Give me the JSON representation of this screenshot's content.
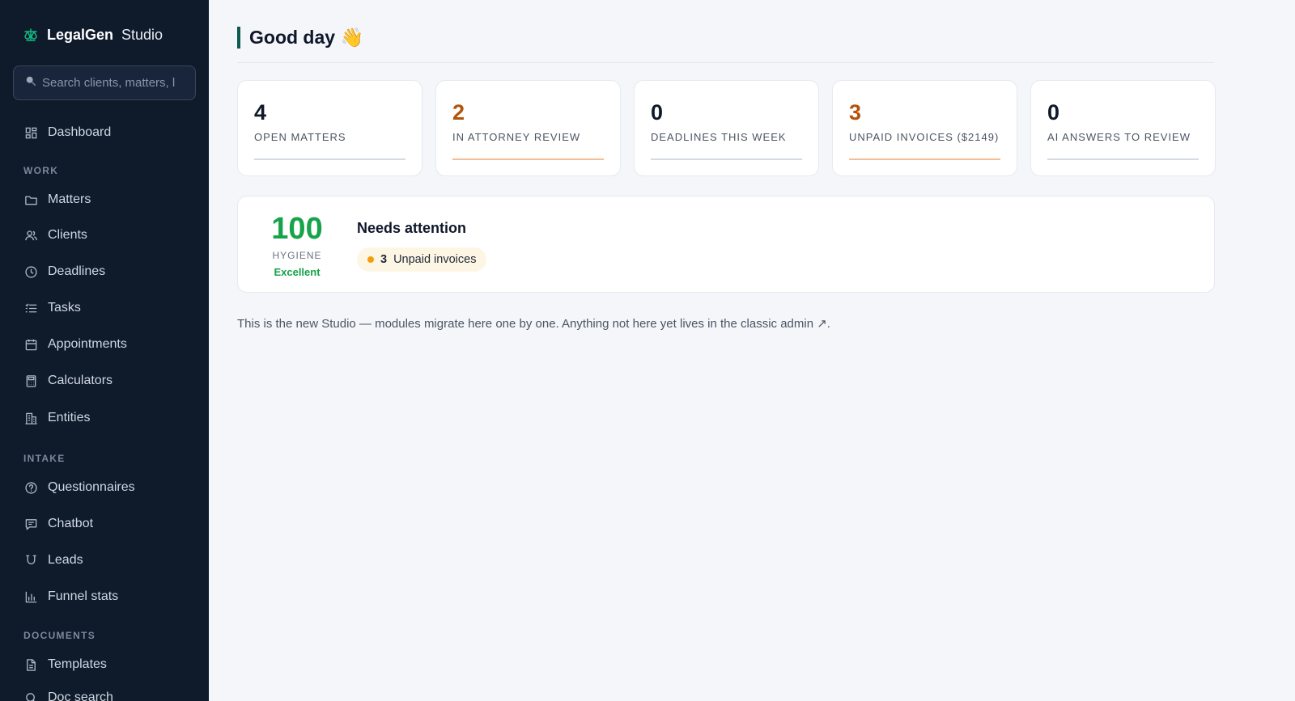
{
  "brand": {
    "name_bold": "LegalGen",
    "name_rest": "Studio",
    "logo_icon": "scale-icon",
    "accent": "#10b981"
  },
  "search": {
    "placeholder": "Search clients, matters, l"
  },
  "sidebar": {
    "dashboard": {
      "label": "Dashboard",
      "icon": "grid-icon"
    },
    "sections": [
      {
        "title": "WORK",
        "items": [
          {
            "label": "Matters",
            "icon": "folder-icon"
          },
          {
            "label": "Clients",
            "icon": "users-icon"
          },
          {
            "label": "Deadlines",
            "icon": "clock-icon"
          },
          {
            "label": "Tasks",
            "icon": "list-icon"
          },
          {
            "label": "Appointments",
            "icon": "calendar-icon"
          },
          {
            "label": "Calculators",
            "icon": "calculator-icon"
          },
          {
            "label": "Entities",
            "icon": "building-icon"
          }
        ]
      },
      {
        "title": "INTAKE",
        "items": [
          {
            "label": "Questionnaires",
            "icon": "question-icon"
          },
          {
            "label": "Chatbot",
            "icon": "chat-icon"
          },
          {
            "label": "Leads",
            "icon": "magnet-icon"
          },
          {
            "label": "Funnel stats",
            "icon": "bar-chart-icon"
          }
        ]
      },
      {
        "title": "DOCUMENTS",
        "items": [
          {
            "label": "Templates",
            "icon": "file-icon"
          },
          {
            "label": "Doc search",
            "icon": "search-icon"
          }
        ]
      }
    ]
  },
  "main": {
    "greeting": "Good day 👋",
    "kpis": [
      {
        "value": "4",
        "label": "OPEN MATTERS",
        "tone": "neutral"
      },
      {
        "value": "2",
        "label": "IN ATTORNEY REVIEW",
        "tone": "warn"
      },
      {
        "value": "0",
        "label": "DEADLINES THIS WEEK",
        "tone": "neutral"
      },
      {
        "value": "3",
        "label": "UNPAID INVOICES ($2149)",
        "tone": "warn"
      },
      {
        "value": "0",
        "label": "AI ANSWERS TO REVIEW",
        "tone": "neutral"
      }
    ],
    "hygiene": {
      "score": "100",
      "label": "HYGIENE",
      "grade": "Excellent",
      "attention_title": "Needs attention",
      "items": [
        {
          "count": "3",
          "label": "Unpaid invoices"
        }
      ]
    },
    "footnote": {
      "text": "This is the new Studio — modules migrate here one by one. Anything not here yet lives in the classic admin ",
      "link": "↗",
      "end": "."
    }
  },
  "colors": {
    "sidebar_bg": "#0f1a2b",
    "warn": "#b45309",
    "success": "#16a34a",
    "attention_dot": "#f59e0b"
  }
}
